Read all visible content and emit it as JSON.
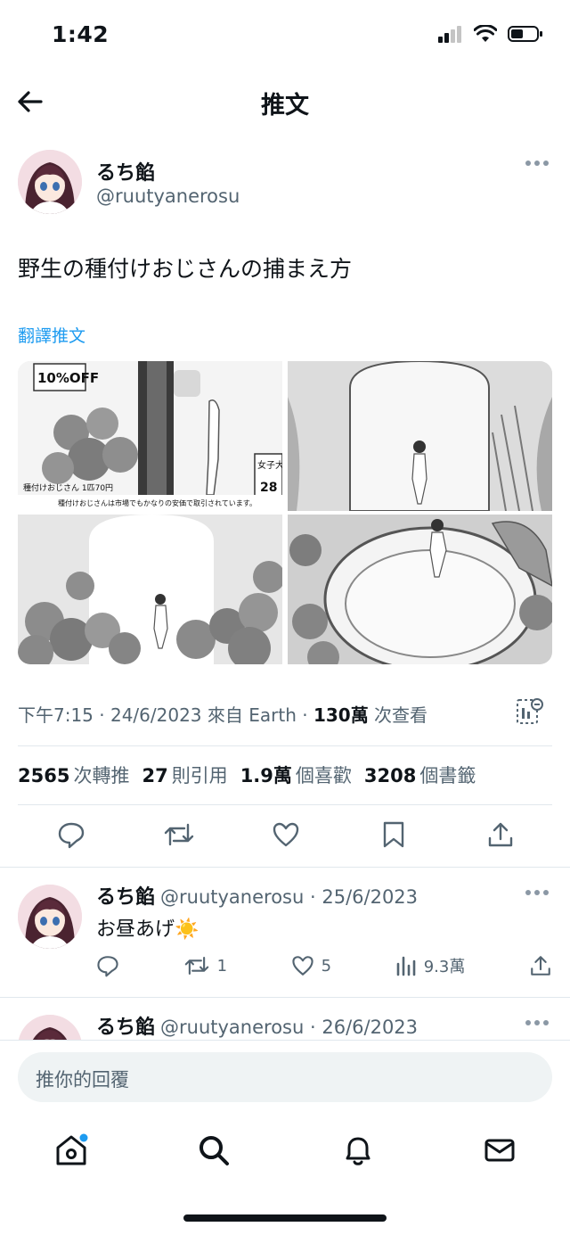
{
  "status_bar": {
    "time": "1:42"
  },
  "nav": {
    "title": "推文"
  },
  "tweet": {
    "author_name": "るち餡",
    "author_handle": "@ruutyanerosu",
    "text": "野生の種付けおじさんの捕まえ方",
    "translate_label": "翻譯推文",
    "meta_time": "下午7:15 · 24/6/2023 來自 Earth · ",
    "meta_views_count": "130萬",
    "meta_views_label": " 次查看",
    "stats": {
      "retweets_count": "2565",
      "retweets_label": "次轉推",
      "quotes_count": "27",
      "quotes_label": "則引用",
      "likes_count": "1.9萬",
      "likes_label": "個喜歡",
      "bookmarks_count": "3208",
      "bookmarks_label": "個書籤"
    },
    "media_text": {
      "sale_badge": "10%OFF",
      "price_label": "種付けおじさん 1匹70円",
      "caption": "種付けおじさんは市場でもかなりの安価で取引されています。",
      "shop_sign": "女子大",
      "price_tag": "28"
    }
  },
  "replies": [
    {
      "author_name": "るち餡",
      "author_handle": "@ruutyanerosu",
      "date": "· 25/6/2023",
      "text": "お昼あげ",
      "emoji": "☀️",
      "retweets": "1",
      "likes": "5",
      "views": "9.3萬"
    },
    {
      "author_name": "るち餡",
      "author_handle": "@ruutyanerosu",
      "date": "· 26/6/2023"
    }
  ],
  "composer": {
    "placeholder": "推你的回覆"
  },
  "icons": {
    "status": [
      "signal-icon",
      "wifi-icon",
      "battery-icon"
    ],
    "tabs": [
      "home-icon",
      "search-icon",
      "notifications-icon",
      "messages-icon"
    ],
    "actions": [
      "reply-icon",
      "retweet-icon",
      "like-icon",
      "bookmark-icon",
      "share-icon"
    ]
  },
  "colors": {
    "accent": "#1d9bf0",
    "secondary_text": "#536471",
    "primary_text": "#0f1419"
  }
}
